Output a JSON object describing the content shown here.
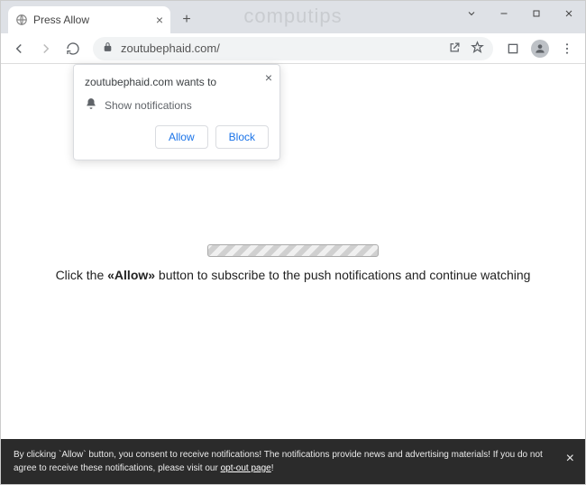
{
  "window": {
    "watermark": "computips"
  },
  "tab": {
    "title": "Press Allow"
  },
  "toolbar": {
    "url": "zoutubephaid.com/"
  },
  "permission": {
    "wants": "zoutubephaid.com wants to",
    "notify": "Show notifications",
    "allow": "Allow",
    "block": "Block"
  },
  "page": {
    "text_before": "Click the ",
    "text_bold": "«Allow»",
    "text_after": " button to subscribe to the push notifications and continue watching"
  },
  "cookie": {
    "line1": "By clicking `Allow` button, you consent to receive notifications! The notifications provide news and advertising materials! If you do not agree to receive these notifications, please visit our ",
    "link": "opt-out page",
    "suffix": "!"
  }
}
